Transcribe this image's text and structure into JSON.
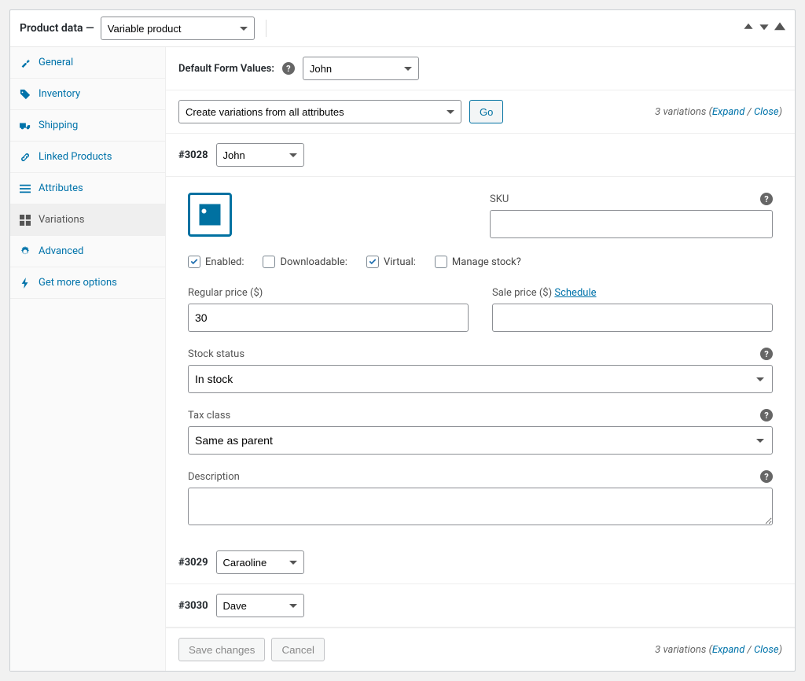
{
  "header": {
    "title": "Product data —",
    "product_type": "Variable product"
  },
  "sidebar": {
    "items": [
      {
        "label": "General"
      },
      {
        "label": "Inventory"
      },
      {
        "label": "Shipping"
      },
      {
        "label": "Linked Products"
      },
      {
        "label": "Attributes"
      },
      {
        "label": "Variations"
      },
      {
        "label": "Advanced"
      },
      {
        "label": "Get more options"
      }
    ]
  },
  "defaults": {
    "label": "Default Form Values:",
    "value": "John"
  },
  "action_bar": {
    "action": "Create variations from all attributes",
    "go": "Go",
    "count_text": "3 variations",
    "expand": "Expand",
    "close": "Close"
  },
  "variation_open": {
    "id": "#3028",
    "attr": "John",
    "sku_label": "SKU",
    "sku_value": "",
    "checks": {
      "enabled": "Enabled:",
      "downloadable": "Downloadable:",
      "virtual": "Virtual:",
      "manage_stock": "Manage stock?"
    },
    "reg_price_label": "Regular price ($)",
    "reg_price_value": "30",
    "sale_price_label": "Sale price ($)",
    "schedule": "Schedule",
    "sale_price_value": "",
    "stock_label": "Stock status",
    "stock_value": "In stock",
    "tax_label": "Tax class",
    "tax_value": "Same as parent",
    "desc_label": "Description",
    "desc_value": ""
  },
  "variation_2": {
    "id": "#3029",
    "attr": "Caraoline"
  },
  "variation_3": {
    "id": "#3030",
    "attr": "Dave"
  },
  "footer": {
    "save": "Save changes",
    "cancel": "Cancel",
    "count_text": "3 variations",
    "expand": "Expand",
    "close": "Close"
  }
}
